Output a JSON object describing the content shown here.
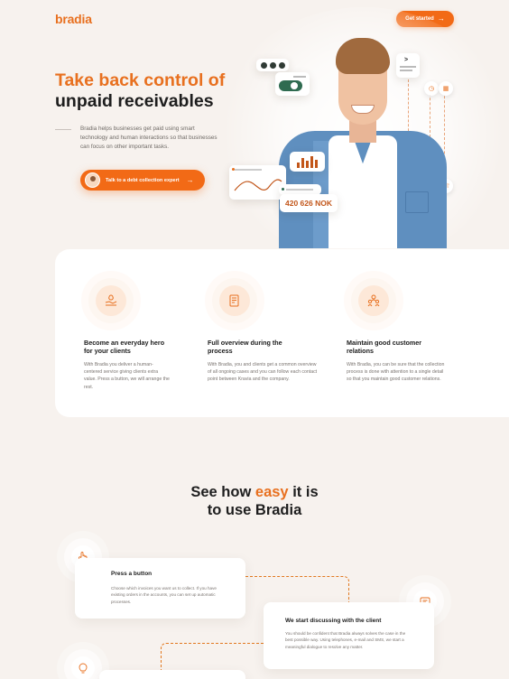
{
  "header": {
    "logo": "bradia",
    "cta_label": "Get started",
    "cta_icon": "arrow-right-icon"
  },
  "hero": {
    "title_accent": "Take back control of",
    "title_rest": "unpaid receivables",
    "description": "Bradia helps businesses get paid using smart technology and human interactions so that businesses can focus on other important tasks.",
    "cta_label": "Talk to a debt collection expert",
    "amount": "420 626 NOK"
  },
  "features": [
    {
      "title": "Become an everyday hero for your clients",
      "description": "With Bradia you deliver a human-centered service giving clients extra value. Press a button, we will arrange the rest.",
      "icon": "hand-heart-icon"
    },
    {
      "title": "Full overview during the process",
      "description": "With Bradia, you and clients get a common overview of all ongoing cases and you can follow each contact point between Kravia and the company.",
      "icon": "document-icon"
    },
    {
      "title": "Maintain good customer relations",
      "description": "With Bradia, you can be sure that the collection process is done with attention to a single detail so that you maintain good customer relations.",
      "icon": "people-icon"
    }
  ],
  "how": {
    "title_pre": "See how",
    "title_accent": "easy",
    "title_post": "it is",
    "title_line2": "to use Bradia"
  },
  "steps": [
    {
      "title": "Press a button",
      "description": "Choose which invoices you want us to collect. If you have existing orders in the accounts, you can set up automatic processes.",
      "icon": "pointer-hand-icon"
    },
    {
      "title": "We start discussing with the client",
      "description": "You should be confident that Bradia always solves the case in the best possible way. Using telephones, e-mail and SMS, we start a meaningful dialogue to resolve any matter.",
      "icon": "chat-icon"
    }
  ],
  "colors": {
    "accent": "#e8701f",
    "button": "#f26a16",
    "background": "#f7f2ee"
  }
}
